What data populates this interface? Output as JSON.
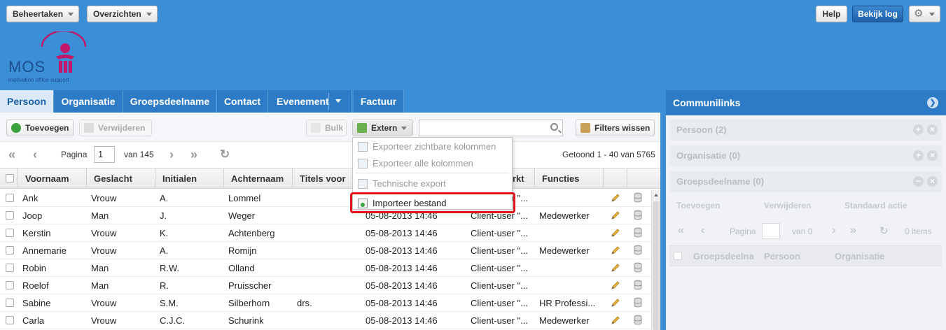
{
  "header": {
    "menu1": "Beheertaken",
    "menu2": "Overzichten",
    "help": "Help",
    "log": "Bekijk log",
    "logo_text": "MOS",
    "logo_sub": "motivation office support"
  },
  "tabs": [
    "Persoon",
    "Organisatie",
    "Groepsdeelname",
    "Contact",
    "Evenement",
    "Factuur"
  ],
  "toolbar": {
    "add": "Toevoegen",
    "remove": "Verwijderen",
    "bulk": "Bulk",
    "extern": "Extern",
    "search_value": "",
    "clear": "Filters wissen"
  },
  "pager": {
    "page_label": "Pagina",
    "page": "1",
    "of": "van 145",
    "shown": "Getoond 1 - 40 van 5765"
  },
  "columns": [
    "Voornaam",
    "Geslacht",
    "Initialen",
    "Achternaam",
    "Titels voor",
    "rkt do",
    "Functies"
  ],
  "rows": [
    {
      "first": "Ank",
      "gender": "Vrouw",
      "init": "A.",
      "last": "Lommel",
      "titles": "",
      "date": "",
      "src": "Client-user \"...",
      "func": ""
    },
    {
      "first": "Joop",
      "gender": "Man",
      "init": "J.",
      "last": "Weger",
      "titles": "",
      "date": "05-08-2013 14:46",
      "src": "Client-user \"...",
      "func": "Medewerker"
    },
    {
      "first": "Kerstin",
      "gender": "Vrouw",
      "init": "K.",
      "last": "Achtenberg",
      "titles": "",
      "date": "05-08-2013 14:46",
      "src": "Client-user \"...",
      "func": ""
    },
    {
      "first": "Annemarie",
      "gender": "Vrouw",
      "init": "A.",
      "last": "Romijn",
      "titles": "",
      "date": "05-08-2013 14:46",
      "src": "Client-user \"...",
      "func": "Medewerker"
    },
    {
      "first": "Robin",
      "gender": "Man",
      "init": "R.W.",
      "last": "Olland",
      "titles": "",
      "date": "05-08-2013 14:46",
      "src": "Client-user \"...",
      "func": ""
    },
    {
      "first": "Roelof",
      "gender": "Man",
      "init": "R.",
      "last": "Pruisscher",
      "titles": "",
      "date": "05-08-2013 14:46",
      "src": "Client-user \"...",
      "func": ""
    },
    {
      "first": "Sabine",
      "gender": "Vrouw",
      "init": "S.M.",
      "last": "Silberhorn",
      "titles": "drs.",
      "date": "05-08-2013 14:46",
      "src": "Client-user \"...",
      "func": "HR Professi..."
    },
    {
      "first": "Carla",
      "gender": "Vrouw",
      "init": "C.J.C.",
      "last": "Schurink",
      "titles": "",
      "date": "05-08-2013 14:46",
      "src": "Client-user \"...",
      "func": "Medewerker"
    }
  ],
  "dropdown": {
    "item1": "Exporteer zichtbare kolommen",
    "item2": "Exporteer alle kolommen",
    "item3": "Technische export",
    "item4": "Importeer bestand"
  },
  "right": {
    "title": "Communilinks",
    "sections": [
      "Persoon (2)",
      "Organisatie (0)",
      "Groepsdeelname (0)"
    ],
    "tool": {
      "add": "Toevoegen",
      "remove": "Verwijderen",
      "action": "Standaard actie"
    },
    "pager": {
      "label": "Pagina",
      "of": "van 0",
      "items": "0 items"
    },
    "columns": [
      "Groepsdeelna",
      "Persoon",
      "Organisatie"
    ]
  }
}
